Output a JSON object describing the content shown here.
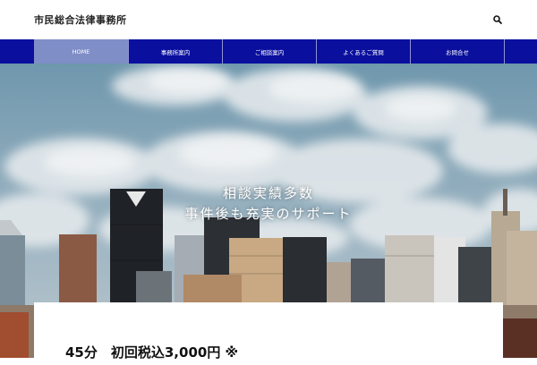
{
  "header": {
    "site_title": "市民総合法律事務所"
  },
  "nav": {
    "items": [
      {
        "label": "HOME",
        "active": true
      },
      {
        "label": "事務所案内"
      },
      {
        "label": "ご相談案内"
      },
      {
        "label": "よくあるご質問"
      },
      {
        "label": "お問合せ"
      }
    ]
  },
  "hero": {
    "line1": "相談実績多数",
    "line2": "事件後も充実のサポート"
  },
  "card": {
    "title": "45分　初回税込3,000円 ※"
  },
  "colors": {
    "nav_bg": "#0a0f9e",
    "nav_active": "#7f8ec6",
    "sky": "#7fa3b6"
  }
}
